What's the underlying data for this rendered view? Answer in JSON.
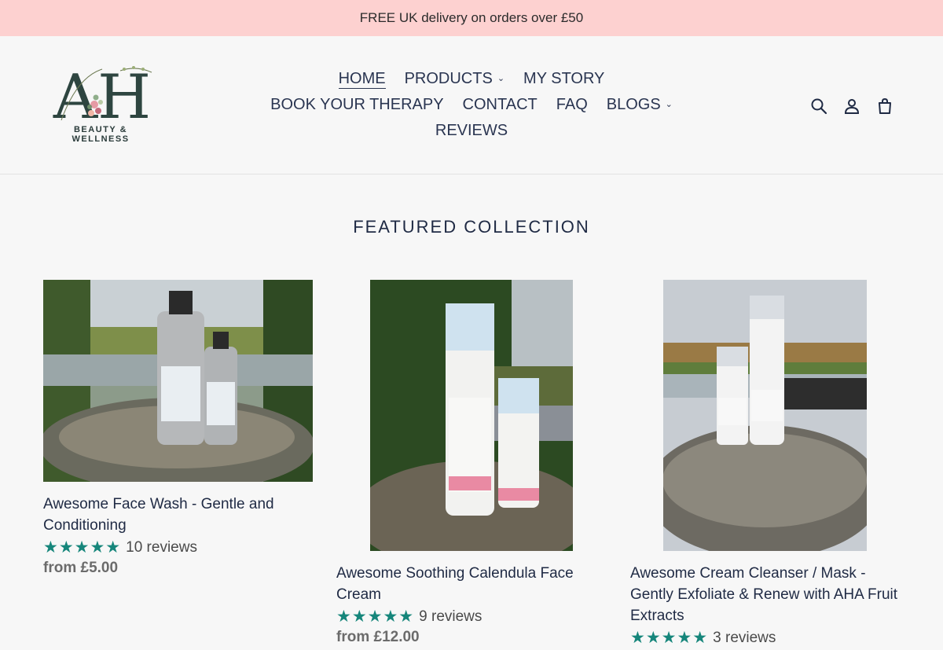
{
  "announcement": "FREE UK delivery on orders over £50",
  "logo": {
    "tagline": "BEAUTY & WELLNESS",
    "monogram": "AH",
    "script": "awesome hugs"
  },
  "nav": {
    "row1": [
      {
        "label": "HOME",
        "active": true,
        "dropdown": false
      },
      {
        "label": "PRODUCTS",
        "dropdown": true
      },
      {
        "label": "MY STORY",
        "dropdown": false
      }
    ],
    "row2": [
      {
        "label": "BOOK YOUR THERAPY",
        "dropdown": false
      },
      {
        "label": "CONTACT",
        "dropdown": false
      },
      {
        "label": "FAQ",
        "dropdown": false
      },
      {
        "label": "BLOGS",
        "dropdown": true
      }
    ],
    "row3": [
      {
        "label": "REVIEWS",
        "dropdown": false
      }
    ]
  },
  "icons": [
    "search-icon",
    "account-icon",
    "cart-icon"
  ],
  "section_title": "FEATURED COLLECTION",
  "products": [
    {
      "title": "Awesome Face Wash - Gentle and Conditioning",
      "stars": "★★★★★",
      "reviews": "10 reviews",
      "price": "from £5.00"
    },
    {
      "title": "Awesome Soothing Calendula Face Cream",
      "stars": "★★★★★",
      "reviews": "9 reviews",
      "price": "from £12.00"
    },
    {
      "title": "Awesome Cream Cleanser / Mask - Gently Exfoliate & Renew with AHA Fruit Extracts",
      "stars": "★★★★★",
      "reviews": "3 reviews",
      "price": ""
    }
  ],
  "colors": {
    "announcement_bg": "#fdd1d0",
    "star": "#16867b",
    "text": "#1f2a44"
  }
}
